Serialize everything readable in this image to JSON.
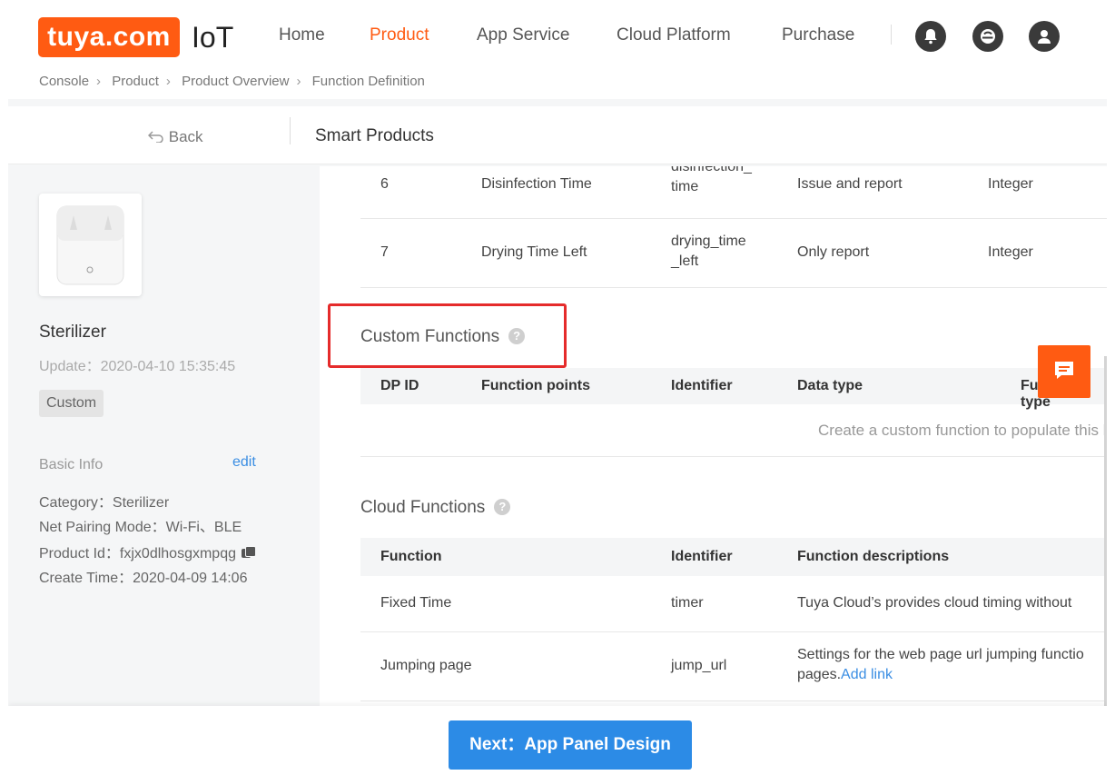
{
  "nav": {
    "logo_text": "tuya.com",
    "brand_suffix": "IoT",
    "items": [
      {
        "label": "Home"
      },
      {
        "label": "Product",
        "active": true
      },
      {
        "label": "App Service"
      },
      {
        "label": "Cloud Platform"
      },
      {
        "label": "Purchase"
      }
    ],
    "icons": [
      "bell-icon",
      "browser-icon",
      "user-icon"
    ],
    "accent_color": "#ff5b12"
  },
  "breadcrumb": [
    "Console",
    "Product",
    "Product Overview",
    "Function Definition"
  ],
  "header": {
    "back_label": "Back",
    "title": "Smart Products"
  },
  "sidebar": {
    "product_name": "Sterilizer",
    "update": "Update：2020-04-10 15:35:45",
    "tag": "Custom",
    "basic_info_label": "Basic Info",
    "edit_label": "edit",
    "category": "Category：Sterilizer",
    "net_pairing": "Net Pairing Mode：Wi-Fi、BLE",
    "product_id": "Product Id：fxjx0dlhosgxmpqg",
    "create_time": "Create Time：2020-04-09 14:06"
  },
  "standard_rows": [
    {
      "dp_id": "6",
      "name": "Disinfection Time",
      "identifier_line1": "disinfection_",
      "identifier_line2": "time",
      "transfer": "Issue and report",
      "type": "Integer"
    },
    {
      "dp_id": "7",
      "name": "Drying Time Left",
      "identifier_line1": "drying_time",
      "identifier_line2": "_left",
      "transfer": "Only report",
      "type": "Integer"
    }
  ],
  "custom_functions": {
    "title": "Custom Functions",
    "columns": [
      "DP ID",
      "Function points",
      "Identifier",
      "Data type",
      "Function type"
    ],
    "empty_message": "Create a custom function to populate this list"
  },
  "cloud_functions": {
    "title": "Cloud Functions",
    "columns": [
      "Function",
      "Identifier",
      "Function descriptions"
    ],
    "rows": [
      {
        "function": "Fixed Time",
        "identifier": "timer",
        "description": "Tuya Cloud’s provides cloud timing without"
      },
      {
        "function": "Jumping page",
        "identifier": "jump_url",
        "description_line1": "Settings for the web page url jumping functio",
        "description_line2": "pages.",
        "link": "Add link"
      }
    ]
  },
  "footer": {
    "next_label": "Next：App Panel Design"
  }
}
